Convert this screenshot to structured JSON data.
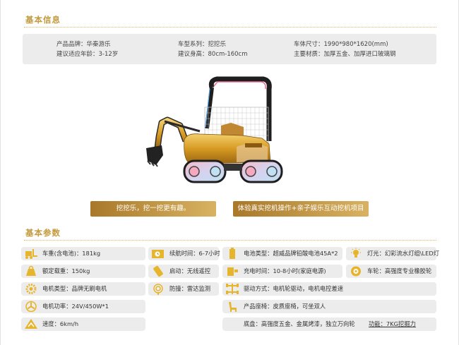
{
  "basic_info": {
    "heading": "基本信息",
    "brand": "产品品牌：华秦游乐",
    "age": "建议适应年龄：3-12岁",
    "series": "车型系列：挖挖乐",
    "height": "建议身高：80cm-160cm",
    "size": "车体尺寸：1990*980*1620(mm)",
    "material": "主要材质：加厚五金、加厚进口玻璃钢"
  },
  "banners": {
    "left": "挖挖乐，挖一挖更有趣。",
    "right": "体验真实挖机操作+亲子娱乐互动挖机项目"
  },
  "params": {
    "heading": "基本参数",
    "weight": "车重(含电池)：181kg",
    "load": "额定载重：150kg",
    "motor": "电机类型：品牌无刷电机",
    "power": "电机功率：24V/450W*1",
    "speed": "速度：6km/h",
    "endurance": "续航时间：6-7小时",
    "start": "启动：无线遥控",
    "anticollision": "防撞：雷达监测",
    "battery": "电池类型：超威品牌铅酸电池45A*2",
    "charge": "充电时间：10-8小时(家庭电源)",
    "drive": "驱动方式：电机轮驱动，电机电控差速",
    "seat": "产品座椅：皮质座椅，可坐双人",
    "chassis": "底盘：高强度五金、金属烤漆，独立万向轮",
    "function": "功能：7KG挖掘力",
    "light": "灯光：幻彩流水灯组\\LED灯",
    "wheel": "车轮：高强度专业橡胶轮"
  },
  "colors": {
    "accent": "#c39a3e",
    "panel": "#ececec",
    "icon": "#e7b52c"
  },
  "icons": [
    "forklift-icon",
    "weight-icon",
    "gear-motor-icon",
    "fan-icon",
    "speed-icon",
    "clock-icon",
    "remote-icon",
    "radar-icon",
    "battery-icon",
    "charger-icon",
    "axle-icon",
    "seat-icon",
    "bulb-icon",
    "wheel-icon"
  ]
}
